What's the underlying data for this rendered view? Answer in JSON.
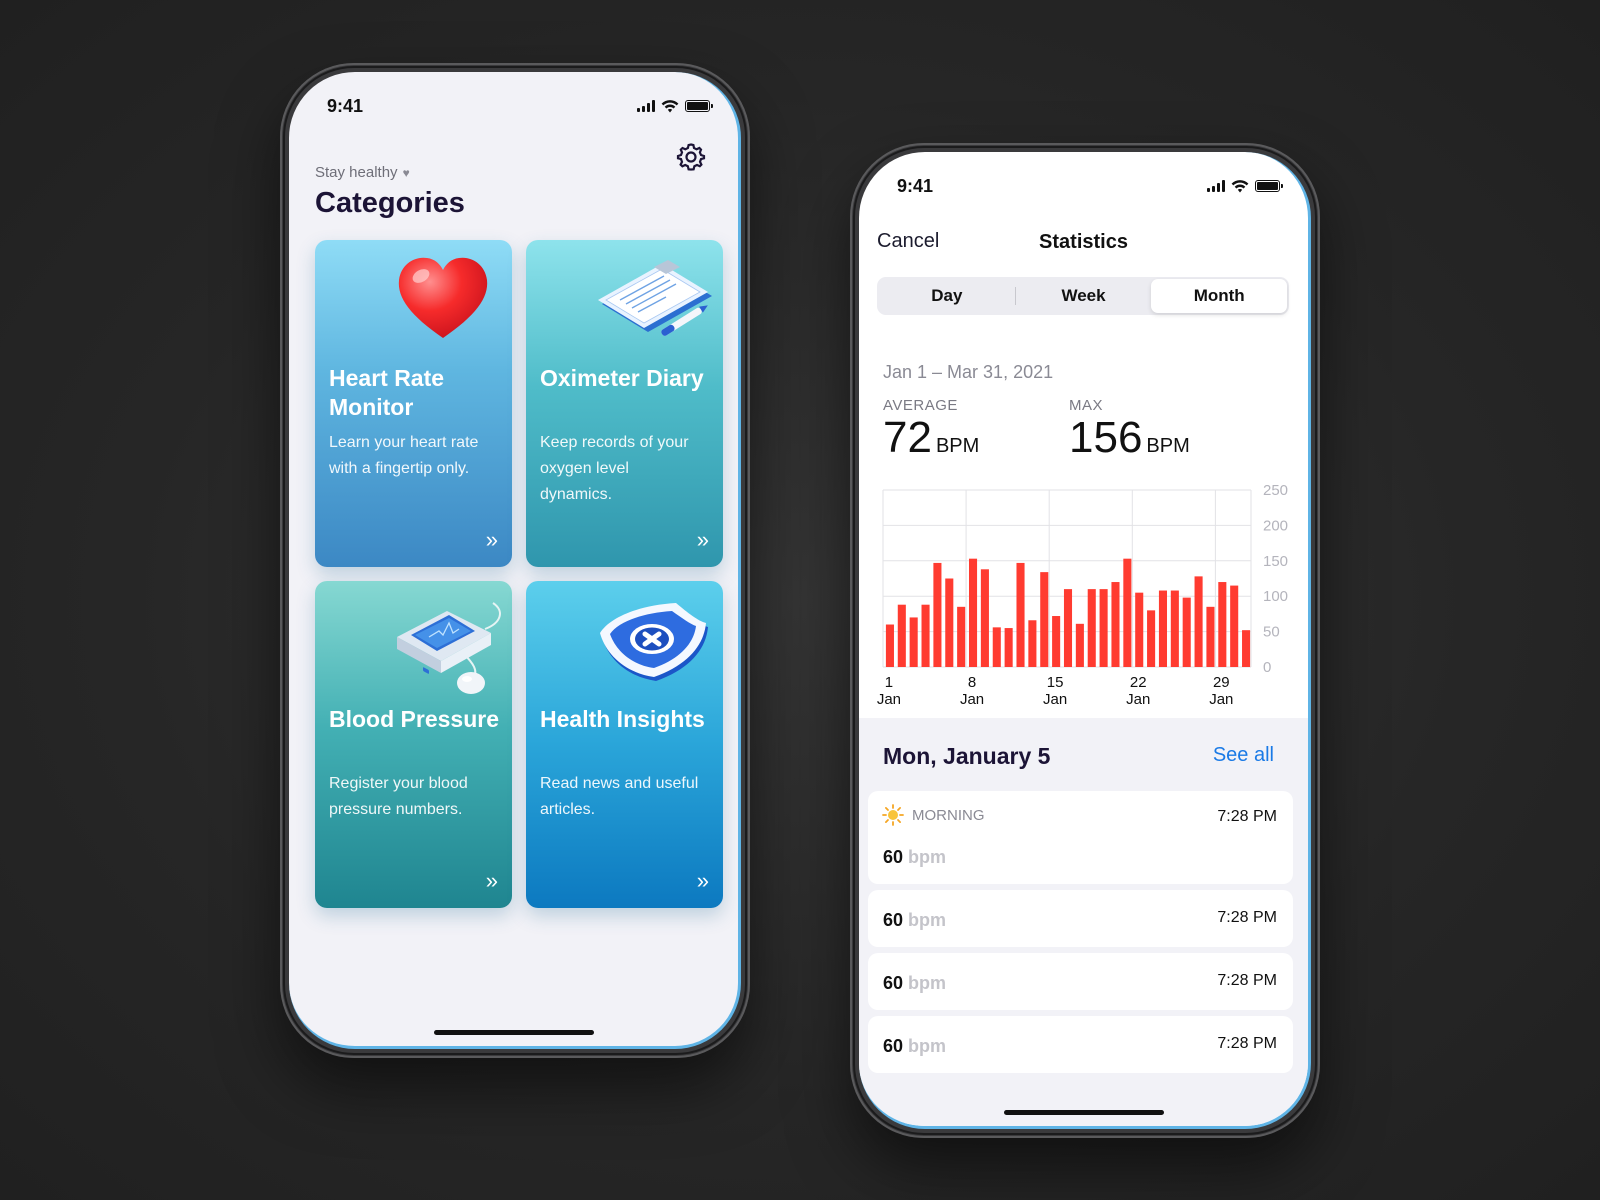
{
  "status_bar": {
    "time": "9:41"
  },
  "categories_screen": {
    "subtitle": "Stay healthy",
    "title": "Categories",
    "cards": [
      {
        "title": "Heart Rate Monitor",
        "description": "Learn your heart rate with a fingertip only.",
        "icon": "heart-icon",
        "arrow": "»"
      },
      {
        "title": "Oximeter Diary",
        "description": "Keep records of your oxygen level dynamics.",
        "icon": "clipboard-icon",
        "arrow": "»"
      },
      {
        "title": "Blood Pressure",
        "description": "Register your blood pressure numbers.",
        "icon": "blood-pressure-monitor-icon",
        "arrow": "»"
      },
      {
        "title": "Health Insights",
        "description": "Read news and useful articles.",
        "icon": "shield-cross-icon",
        "arrow": "»"
      }
    ]
  },
  "statistics_screen": {
    "cancel_label": "Cancel",
    "title": "Statistics",
    "segments": [
      "Day",
      "Week",
      "Month"
    ],
    "active_segment": "Month",
    "date_range": "Jan 1 – Mar 31, 2021",
    "average": {
      "label": "AVERAGE",
      "value": "72",
      "unit": "BPM"
    },
    "max": {
      "label": "MAX",
      "value": "156",
      "unit": "BPM"
    },
    "day_title": "Mon, January 5",
    "see_all_label": "See all",
    "entries": [
      {
        "period": "MORNING",
        "value": "60",
        "unit": "bpm",
        "time": "7:28 PM"
      },
      {
        "value": "60",
        "unit": "bpm",
        "time": "7:28 PM"
      },
      {
        "value": "60",
        "unit": "bpm",
        "time": "7:28 PM"
      },
      {
        "value": "60",
        "unit": "bpm",
        "time": "7:28 PM"
      }
    ]
  },
  "chart_data": {
    "type": "bar",
    "bar_color": "#ff3b30",
    "ylim": [
      0,
      250
    ],
    "y_ticks": [
      0,
      50,
      100,
      150,
      200,
      250
    ],
    "x_ticks": [
      {
        "day": 1,
        "top": "1",
        "bottom": "Jan"
      },
      {
        "day": 8,
        "top": "8",
        "bottom": "Jan"
      },
      {
        "day": 15,
        "top": "15",
        "bottom": "Jan"
      },
      {
        "day": 22,
        "top": "22",
        "bottom": "Jan"
      },
      {
        "day": 29,
        "top": "29",
        "bottom": "Jan"
      }
    ],
    "x_range": [
      1,
      31
    ],
    "values": [
      60,
      88,
      70,
      88,
      147,
      125,
      85,
      153,
      138,
      56,
      55,
      147,
      66,
      134,
      72,
      110,
      61,
      110,
      110,
      120,
      153,
      105,
      80,
      108,
      108,
      98,
      128,
      85,
      120,
      115,
      52
    ],
    "grid": true
  }
}
